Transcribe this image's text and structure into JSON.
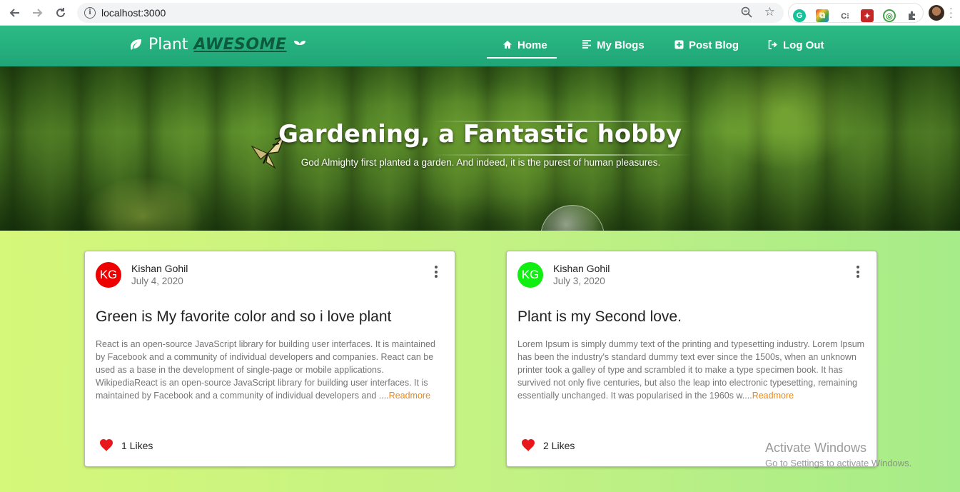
{
  "browser": {
    "url": "localhost:3000"
  },
  "app": {
    "brand_plant": "Plant",
    "brand_awesome": "AWESOME",
    "nav": [
      {
        "label": "Home",
        "icon": "home-icon"
      },
      {
        "label": "My Blogs",
        "icon": "list-icon"
      },
      {
        "label": "Post Blog",
        "icon": "plus-square-icon"
      },
      {
        "label": "Log Out",
        "icon": "logout-icon"
      }
    ],
    "active_nav": "Home"
  },
  "hero": {
    "title": "Gardening, a Fantastic hobby",
    "subtitle": "God Almighty first planted a garden. And indeed, it is the purest of human pleasures."
  },
  "posts": [
    {
      "initials": "KG",
      "avatar_color": "#ee0000",
      "author": "Kishan Gohil",
      "date": "July 4, 2020",
      "title": "Green is My favorite color and so i love plant",
      "excerpt": "React is an open-source JavaScript library for building user interfaces. It is maintained by Facebook and a community of individual developers and companies. React can be used as a base in the development of single-page or mobile applications. WikipediaReact is an open-source JavaScript library for building user interfaces. It is maintained by Facebook and a community of individual developers and ....",
      "readmore": "Readmore",
      "likes": "1 Likes"
    },
    {
      "initials": "KG",
      "avatar_color": "#11ee11",
      "author": "Kishan Gohil",
      "date": "July 3, 2020",
      "title": "Plant is my Second love.",
      "excerpt": "Lorem Ipsum is simply dummy text of the printing and typesetting industry. Lorem Ipsum has been the industry's standard dummy text ever since the 1500s, when an unknown printer took a galley of type and scrambled it to make a type specimen book. It has survived not only five centuries, but also the leap into electronic typesetting, remaining essentially unchanged. It was popularised in the 1960s w....",
      "readmore": "Readmore",
      "likes": "2 Likes"
    }
  ],
  "watermark": {
    "line1": "Activate Windows",
    "line2": "Go to Settings to activate Windows."
  },
  "colors": {
    "appbar": "#22ad7c",
    "heart": "#e8171c",
    "readmore": "#e8891b"
  }
}
